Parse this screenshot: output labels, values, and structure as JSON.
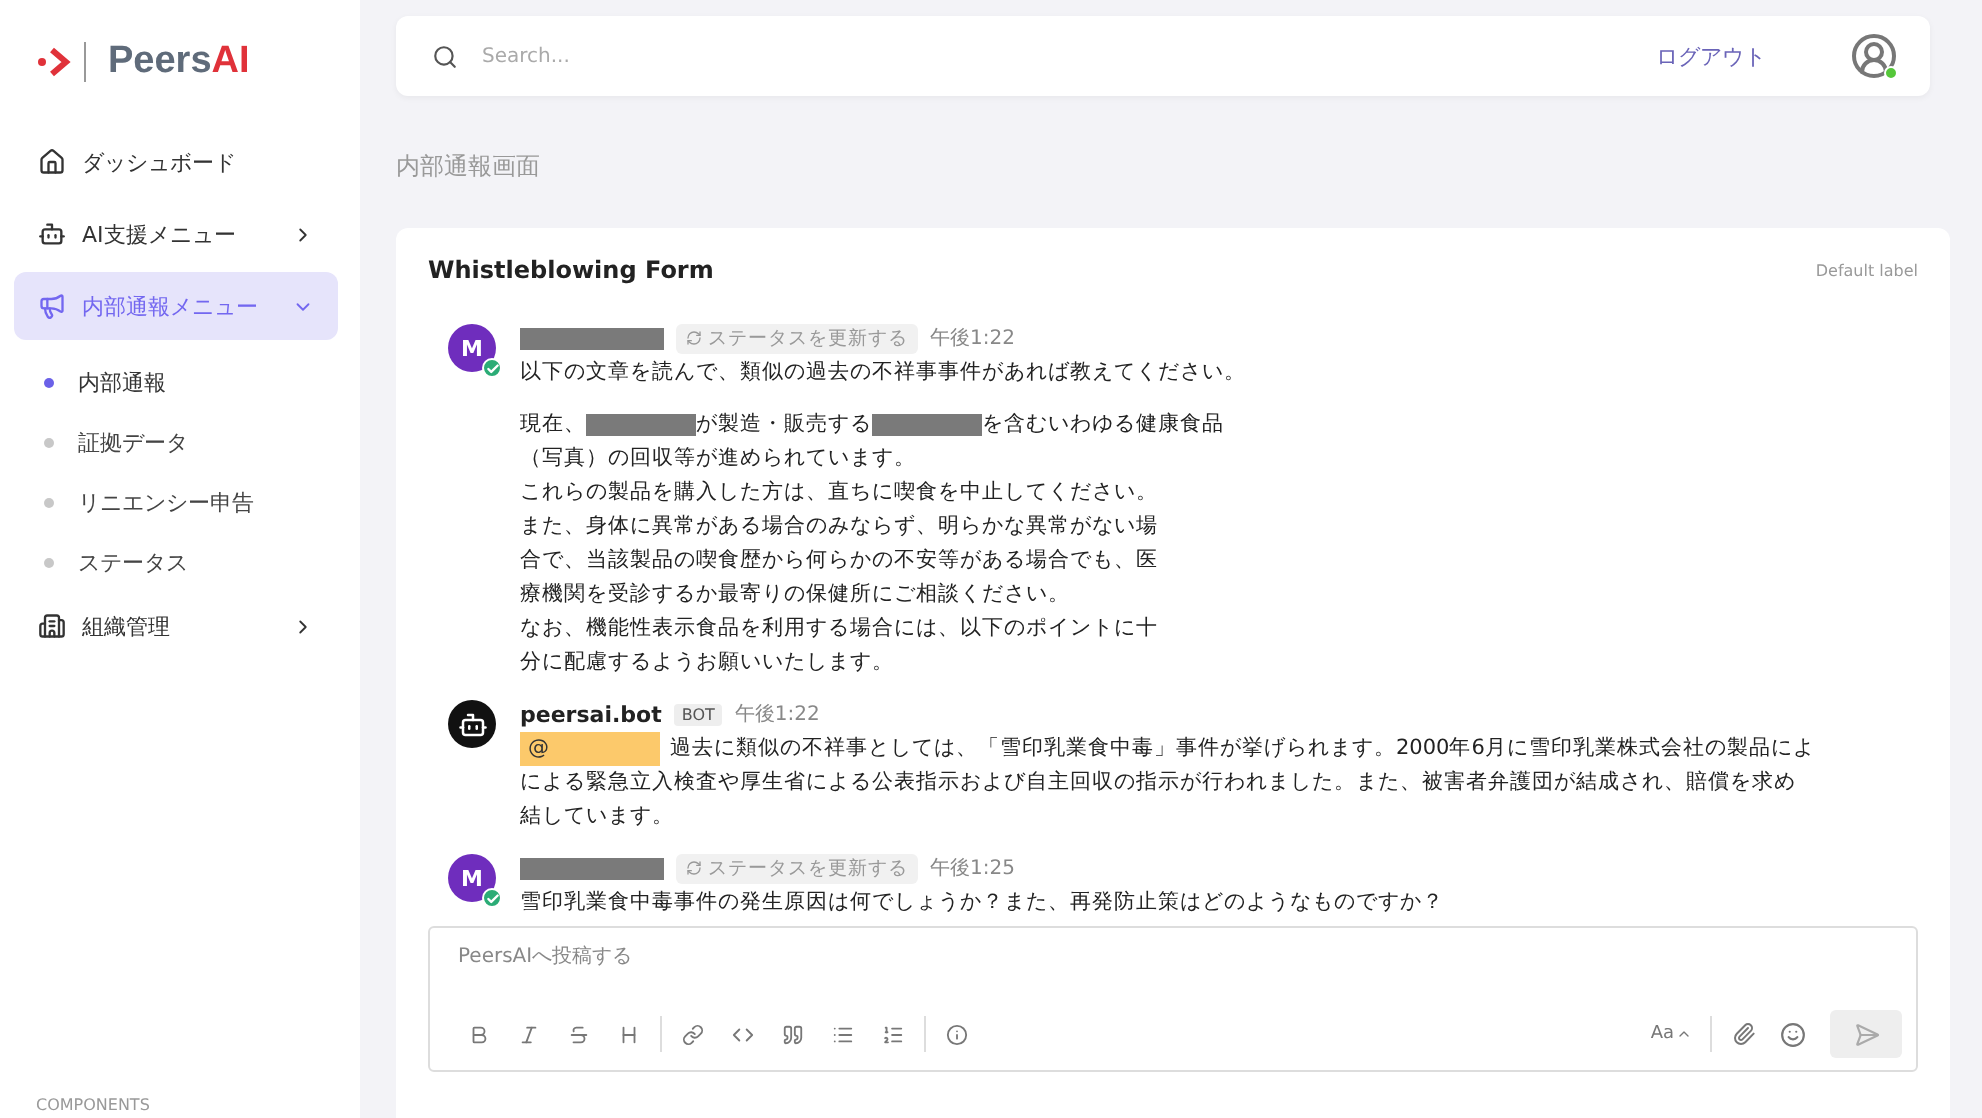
{
  "logo": {
    "name": "Peers",
    "accent": "AI"
  },
  "sidebar": {
    "items": [
      {
        "label": "ダッシュボード",
        "kind": "link"
      },
      {
        "label": "AI支援メニュー",
        "kind": "menu",
        "expanded": false,
        "selected": false
      },
      {
        "label": "内部通報メニュー",
        "kind": "menu",
        "expanded": true,
        "selected": true,
        "children": [
          {
            "label": "内部通報",
            "selected": true
          },
          {
            "label": "証拠データ",
            "selected": false
          },
          {
            "label": "リニエンシー申告",
            "selected": false
          },
          {
            "label": "ステータス",
            "selected": false
          }
        ]
      },
      {
        "label": "組織管理",
        "kind": "menu",
        "expanded": false,
        "selected": false
      }
    ],
    "section": "COMPONENTS"
  },
  "topbar": {
    "search": {
      "placeholder": "Search..."
    },
    "logout": "ログアウト",
    "user_online": true
  },
  "page_title": "内部通報画面",
  "card": {
    "title": "Whistleblowing Form",
    "label": "Default label",
    "messages": [
      {
        "kind": "user",
        "avatar": "M",
        "status": "ステータスを更新する",
        "time": "午後1:22",
        "blocks": [
          [
            [
              {
                "kind": "text",
                "text": "以下の文章を読んで、類似の過去の不祥事事件があれば教えてください。"
              }
            ]
          ],
          [
            [
              {
                "kind": "text",
                "text": "現在、"
              },
              {
                "kind": "redacted"
              },
              {
                "kind": "text",
                "text": "が製造・販売する"
              },
              {
                "kind": "redacted"
              },
              {
                "kind": "text",
                "text": "を含むいわゆる健康食品"
              }
            ],
            [
              {
                "kind": "text",
                "text": "（写真）の回収等が進められています。"
              }
            ],
            [
              {
                "kind": "text",
                "text": "これらの製品を購入した方は、直ちに喫食を中止してください。"
              }
            ],
            [
              {
                "kind": "text",
                "text": "また、身体に異常がある場合のみならず、明らかな異常がない場"
              }
            ],
            [
              {
                "kind": "text",
                "text": "合で、当該製品の喫食歴から何らかの不安等がある場合でも、医"
              }
            ],
            [
              {
                "kind": "text",
                "text": "療機関を受診するか最寄りの保健所にご相談ください。"
              }
            ],
            [
              {
                "kind": "text",
                "text": "なお、機能性表示食品を利用する場合には、以下のポイントに十"
              }
            ],
            [
              {
                "kind": "text",
                "text": "分に配慮するようお願いいたします。"
              }
            ]
          ]
        ]
      },
      {
        "kind": "bot",
        "name": "peersai.bot",
        "badge": "BOT",
        "time": "午後1:22",
        "blocks": [
          [
            [
              {
                "kind": "mention",
                "text": "@"
              },
              {
                "kind": "text",
                "text": "過去に類似の不祥事としては、「雪印乳業食中毒」事件が挙げられます。2000年6月に雪印乳業株式会社の製品によ"
              }
            ],
            [
              {
                "kind": "text",
                "text": "による緊急立入検査や厚生省による公表指示および自主回収の指示が行われました。また、被害者弁護団が結成され、賠償を求め"
              }
            ],
            [
              {
                "kind": "text",
                "text": "結しています。"
              }
            ]
          ]
        ]
      },
      {
        "kind": "user",
        "avatar": "M",
        "status": "ステータスを更新する",
        "time": "午後1:25",
        "blocks": [
          [
            [
              {
                "kind": "text",
                "text": "雪印乳業食中毒事件の発生原因は何でしょうか？また、再発防止策はどのようなものですか？"
              }
            ]
          ]
        ]
      }
    ],
    "composer": {
      "placeholder": "PeersAIへ投稿する",
      "font_button": "Aa"
    }
  }
}
